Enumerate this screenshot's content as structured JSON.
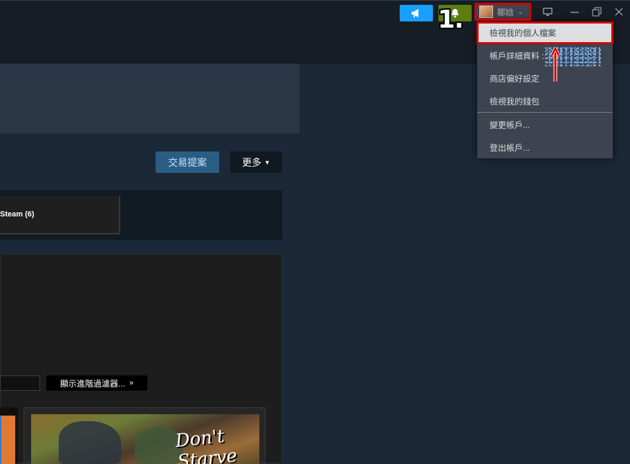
{
  "titlebar": {
    "user_name": "鄒娢",
    "window_controls": [
      "monitor-icon",
      "minimize-icon",
      "restore-icon",
      "close-icon"
    ]
  },
  "annotation": {
    "step_label": "1."
  },
  "account_menu": {
    "items": [
      {
        "label": "檢視我的個人檔案",
        "highlighted": true
      },
      {
        "label": "帳戶詳細資料 :"
      },
      {
        "label": "商店偏好設定"
      },
      {
        "label": "檢視我的錢包"
      },
      {
        "label": "變更帳戶..."
      },
      {
        "label": "登出帳戶..."
      }
    ]
  },
  "actions": {
    "trade_offer": "交易提案",
    "more": "更多"
  },
  "tabs": {
    "steam": "Steam (6)"
  },
  "filters": {
    "advanced_filters": "顯示進階過濾器..."
  },
  "item": {
    "logo_text": "Don't Starve"
  },
  "colors": {
    "announce": "#1a9fff",
    "notify": "#5c7e10",
    "callout": "#d20000",
    "trade_button": "#2b5d84"
  }
}
